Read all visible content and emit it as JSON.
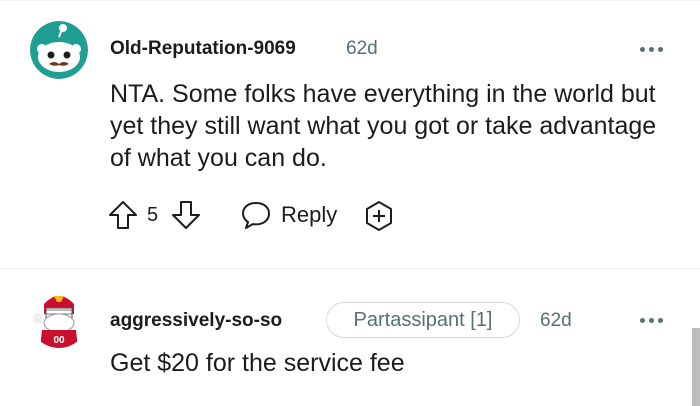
{
  "comments": [
    {
      "username": "Old-Reputation-9069",
      "time": "62d",
      "body": "NTA. Some folks have everything in the world but yet they still want what you got or take advantage of what you can do.",
      "vote_count": "5",
      "reply_label": "Reply",
      "avatar_icon": "snoo-avatar-mustache-icon"
    },
    {
      "username": "aggressively-so-so",
      "flair": "Partassipant [1]",
      "time": "62d",
      "body": "Get $20 for the service fee",
      "avatar_icon": "snoo-avatar-football-icon"
    }
  ],
  "colors": {
    "text": "#1c1c1c",
    "muted": "#576f76",
    "avatar_teal": "#1f9e93",
    "divider": "#edeff1"
  }
}
